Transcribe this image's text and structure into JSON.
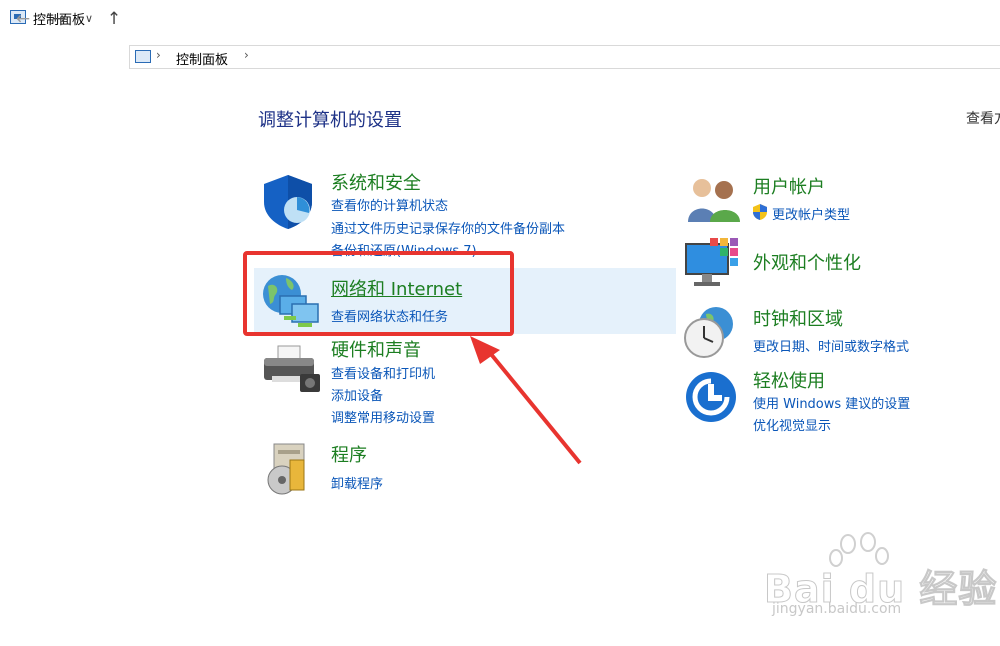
{
  "window": {
    "title": "控制面板"
  },
  "nav": {
    "back_icon": "←",
    "forward_icon": "→",
    "recent_icon": "∨",
    "up_icon": "↑",
    "separator": "›",
    "address": "控制面板"
  },
  "main": {
    "heading": "调整计算机的设置",
    "view_by": "查看方"
  },
  "categories": {
    "system": {
      "title": "系统和安全",
      "links": [
        "查看你的计算机状态",
        "通过文件历史记录保存你的文件备份副本",
        "备份和还原(Windows 7)"
      ]
    },
    "network": {
      "title": "网络和 Internet",
      "links": [
        "查看网络状态和任务"
      ]
    },
    "hardware": {
      "title": "硬件和声音",
      "links": [
        "查看设备和打印机",
        "添加设备",
        "调整常用移动设置"
      ]
    },
    "programs": {
      "title": "程序",
      "links": [
        "卸载程序"
      ]
    },
    "accounts": {
      "title": "用户帐户",
      "links": [
        "更改帐户类型"
      ]
    },
    "appearance": {
      "title": "外观和个性化",
      "links": []
    },
    "clock": {
      "title": "时钟和区域",
      "links": [
        "更改日期、时间或数字格式"
      ]
    },
    "ease": {
      "title": "轻松使用",
      "links": [
        "使用 Windows 建议的设置",
        "优化视觉显示"
      ]
    }
  },
  "annotation": {
    "highlight_color": "#e8342f"
  },
  "watermark": {
    "brand": "Bai du 经验",
    "url": "jingyan.baidu.com"
  }
}
